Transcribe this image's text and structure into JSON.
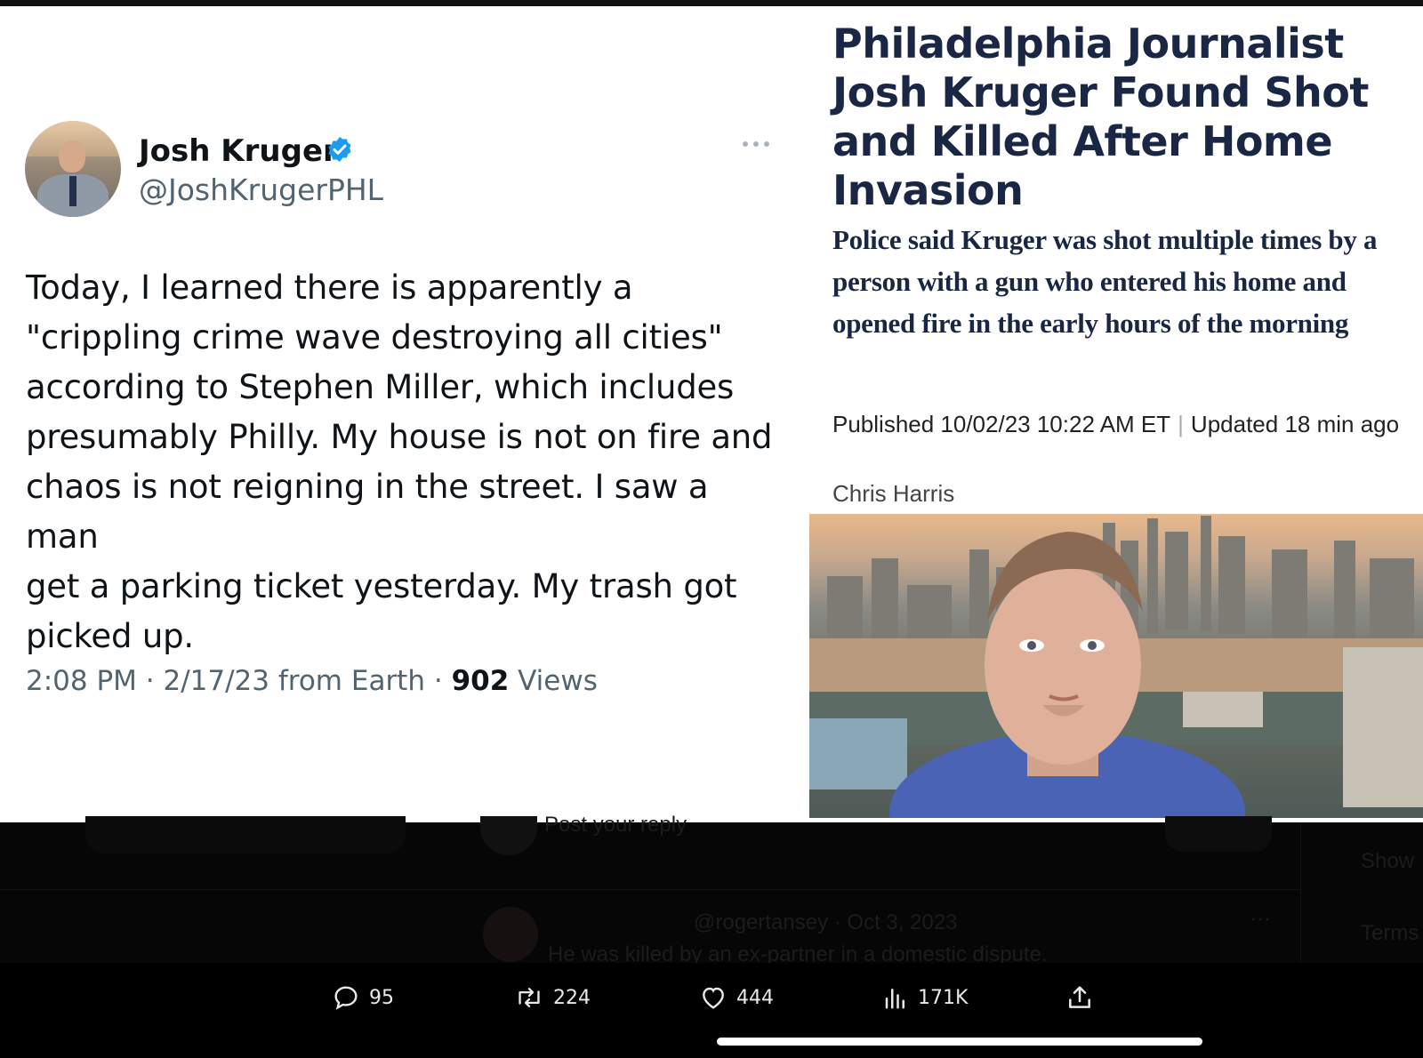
{
  "tweet": {
    "display_name": "Josh Kruger",
    "handle": "@JoshKrugerPHL",
    "verified_icon": "verified-badge-icon",
    "text": "Today, I learned there is apparently a\n\"crippling crime wave destroying all cities\"\naccording to Stephen Miller, which includes\npresumably Philly. My house is not on fire and\nchaos is not reigning in the street. I saw a man\nget a parking ticket yesterday. My trash got\npicked up.",
    "time": "2:08 PM",
    "date": "2/17/23",
    "source": "from Earth",
    "views_count": "902",
    "views_label": "Views"
  },
  "article": {
    "headline": "Philadelphia Journalist Josh Kruger Found Shot and Killed After Home Invasion",
    "subhead": "Police said Kruger was shot multiple times by a person with a gun who entered his home and opened fire in the early hours of the morning",
    "published": "Published 10/02/23 10:22 AM ET",
    "updated": "Updated 18 min ago",
    "author": "Chris Harris"
  },
  "reply_area": {
    "placeholder": "Post your reply",
    "reply_handle": "@rogertansey · Oct 3, 2023",
    "reply_text": "He was killed by an ex-partner in a domestic dispute.",
    "side_text_1": "Show",
    "side_text_2": "Terms"
  },
  "actions": {
    "replies": "95",
    "reposts": "224",
    "likes": "444",
    "views": "171K"
  },
  "colors": {
    "verified_blue": "#1d9bf0",
    "headline_navy": "#1a2744",
    "meta_gray": "#536471"
  }
}
